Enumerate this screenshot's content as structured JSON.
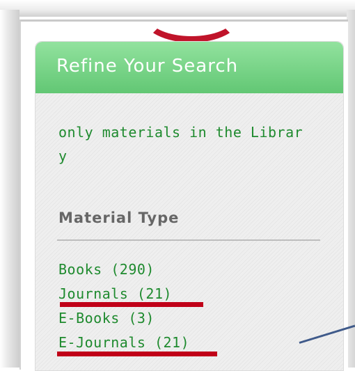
{
  "panel": {
    "title": "Refine Your Search",
    "library_filter": "only materials in the Library"
  },
  "material_type": {
    "heading": "Material Type",
    "items": [
      {
        "label": "Books (290)",
        "highlighted": false
      },
      {
        "label": "Journals (21)",
        "highlighted": true
      },
      {
        "label": "E-Books (3)",
        "highlighted": false
      },
      {
        "label": "E-Journals (21)",
        "highlighted": true
      }
    ]
  },
  "colors": {
    "header_green": "#6fd07f",
    "link_green": "#1e8a2e",
    "annotation_red": "#c00018",
    "pointer_blue": "#3f5a8a"
  }
}
